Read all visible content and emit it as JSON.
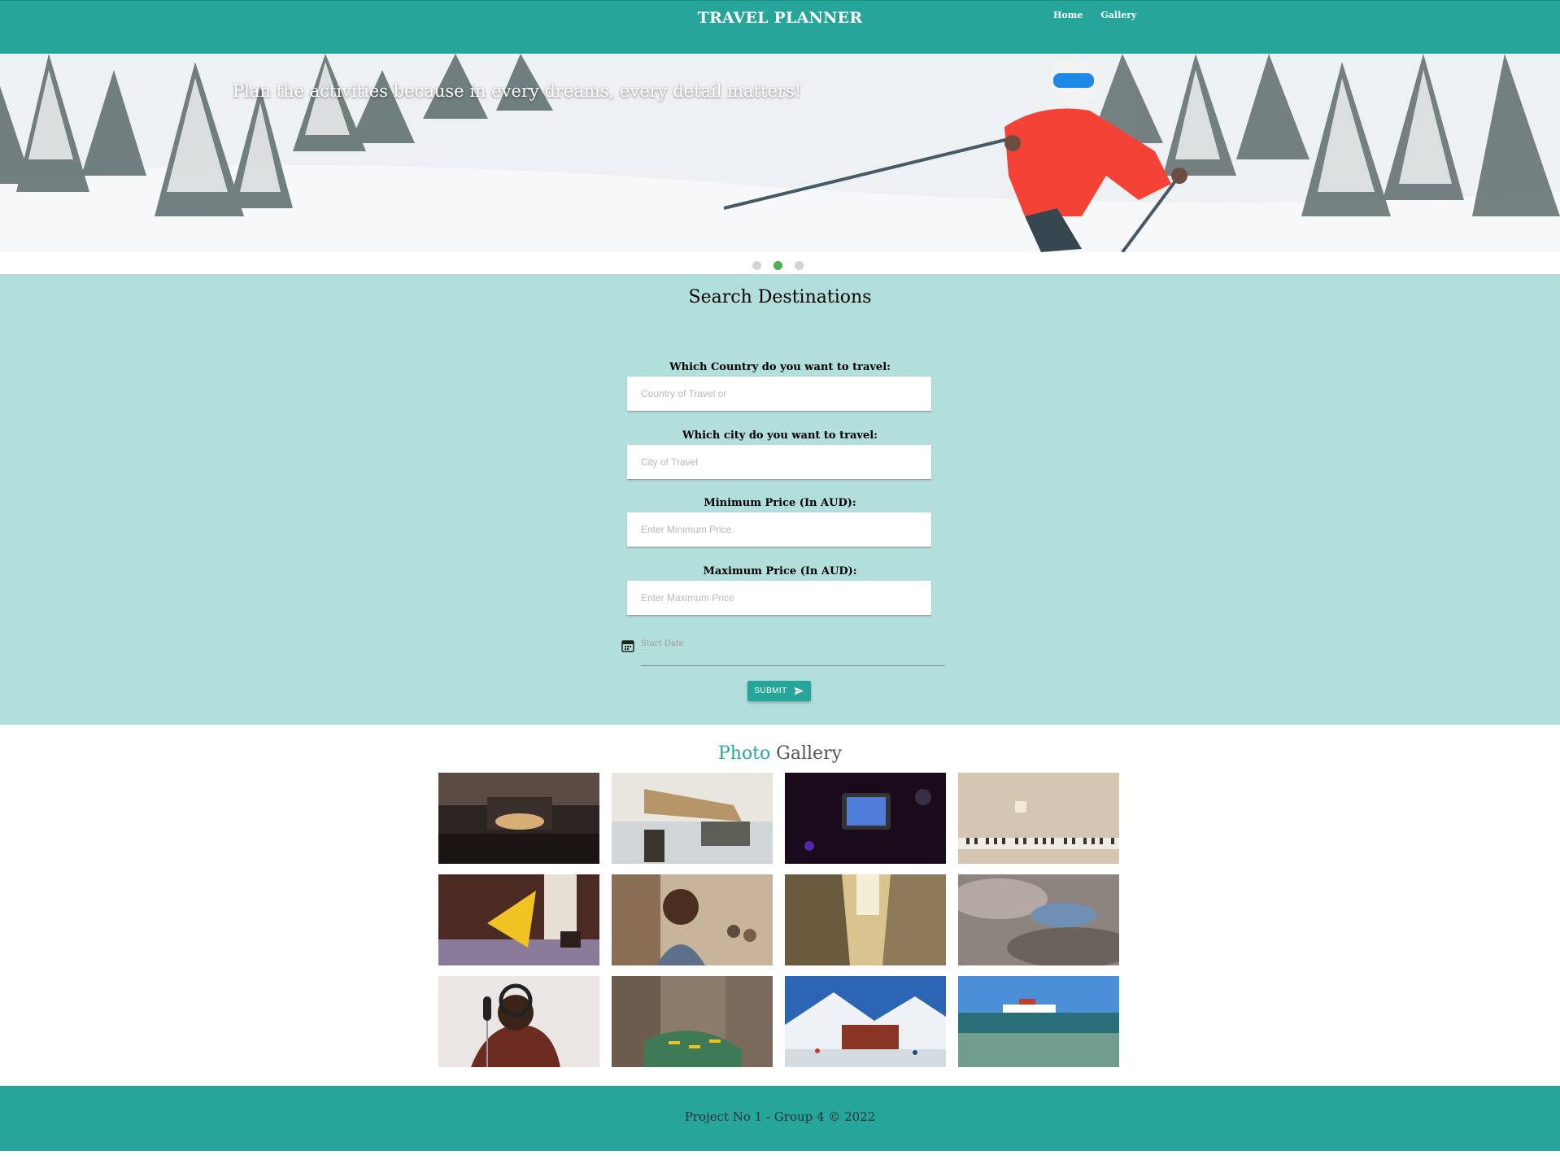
{
  "nav": {
    "brand": "TRAVEL PLANNER",
    "links": [
      {
        "label": "Home"
      },
      {
        "label": "Gallery"
      }
    ]
  },
  "hero": {
    "caption": "Plan the activities because in every dreams, every detail matters!",
    "slide_count": 3,
    "active_slide": 2
  },
  "search": {
    "title": "Search Destinations",
    "country_label": "Which Country do you want to travel:",
    "country_placeholder": "Country of Travel or",
    "city_label": "Which city do you want to travel:",
    "city_placeholder": "City of Travel",
    "min_price_label": "Minimum Price (In AUD):",
    "min_price_placeholder": "Enter Minimum Price",
    "max_price_label": "Maximum Price (In AUD):",
    "max_price_placeholder": "Enter Maximum Price",
    "start_date_placeholder": "Start Date",
    "submit_label": "SUBMIT",
    "icons": {
      "date": "calendar-icon",
      "submit": "send-icon"
    }
  },
  "gallery": {
    "title_accent": "Photo",
    "title_rest": "Gallery",
    "photos": [
      "concert-stage-photo",
      "airport-traveler-photo",
      "phone-screen-photo",
      "piano-keys-photo",
      "yellow-umbrella-photo",
      "smiling-man-street-photo",
      "narrow-alley-photo",
      "cloudy-sky-photo",
      "headphones-microphone-photo",
      "kayaks-cliffs-photo",
      "snowy-mountain-resort-photo",
      "cruise-ship-sea-photo"
    ]
  },
  "footer": {
    "text": "Project No 1 - Group 4 © 2022"
  },
  "colors": {
    "primary": "#26a69a",
    "search_bg": "#b2dfdb",
    "dot_active": "#4caf50",
    "dot_inactive": "#d3d3d3",
    "gallery_accent": "#26a69a"
  }
}
